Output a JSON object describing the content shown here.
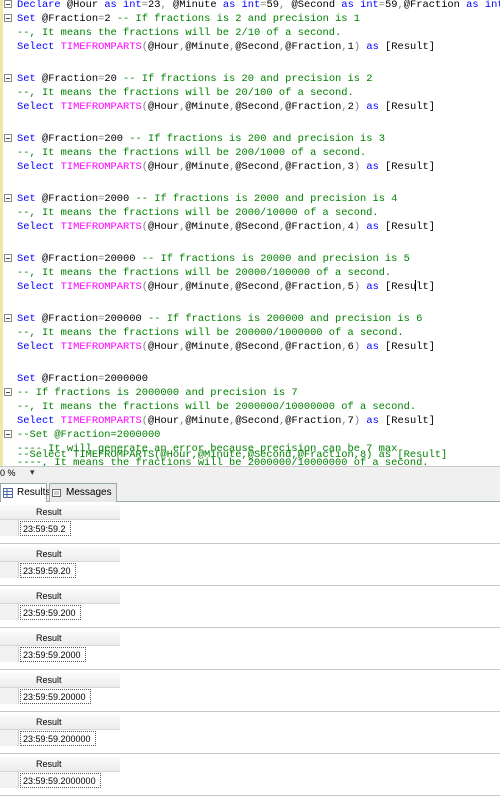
{
  "editor": {
    "lines": [
      {
        "fold": true,
        "segments": [
          [
            "kw",
            "Declare "
          ],
          [
            "var",
            "@Hour "
          ],
          [
            "kw",
            "as int"
          ],
          [
            "op",
            "="
          ],
          [
            "tx",
            "23"
          ],
          [
            "op",
            ", "
          ],
          [
            "var",
            "@Minute "
          ],
          [
            "kw",
            "as int"
          ],
          [
            "op",
            "="
          ],
          [
            "tx",
            "59"
          ],
          [
            "op",
            ", "
          ],
          [
            "var",
            "@Second "
          ],
          [
            "kw",
            "as int"
          ],
          [
            "op",
            "="
          ],
          [
            "tx",
            "59"
          ],
          [
            "op",
            ","
          ],
          [
            "var",
            "@Fraction "
          ],
          [
            "kw",
            "as int"
          ]
        ]
      },
      {
        "fold": true,
        "segments": [
          [
            "kw",
            "Set "
          ],
          [
            "var",
            "@Fraction"
          ],
          [
            "op",
            "="
          ],
          [
            "tx",
            "2 "
          ],
          [
            "cm",
            "-- If fractions is 2 and precision is 1"
          ]
        ]
      },
      {
        "fold": false,
        "segments": [
          [
            "cm",
            "--, It means the fractions will be 2/10 of a second."
          ]
        ]
      },
      {
        "fold": false,
        "segments": [
          [
            "kw",
            "Select "
          ],
          [
            "fn",
            "TIMEFROMPARTS"
          ],
          [
            "op",
            "("
          ],
          [
            "var",
            "@Hour"
          ],
          [
            "op",
            ","
          ],
          [
            "var",
            "@Minute"
          ],
          [
            "op",
            ","
          ],
          [
            "var",
            "@Second"
          ],
          [
            "op",
            ","
          ],
          [
            "var",
            "@Fraction"
          ],
          [
            "op",
            ","
          ],
          [
            "tx",
            "1"
          ],
          [
            "op",
            ") "
          ],
          [
            "kw",
            "as "
          ],
          [
            "tx",
            "[Result]"
          ]
        ]
      },
      {
        "fold": false,
        "segments": []
      },
      {
        "fold": true,
        "segments": [
          [
            "kw",
            "Set "
          ],
          [
            "var",
            "@Fraction"
          ],
          [
            "op",
            "="
          ],
          [
            "tx",
            "20 "
          ],
          [
            "cm",
            "-- If fractions is 20 and precision is 2"
          ]
        ]
      },
      {
        "fold": false,
        "segments": [
          [
            "cm",
            "--, It means the fractions will be 20/100 of a second."
          ]
        ]
      },
      {
        "fold": false,
        "segments": [
          [
            "kw",
            "Select "
          ],
          [
            "fn",
            "TIMEFROMPARTS"
          ],
          [
            "op",
            "("
          ],
          [
            "var",
            "@Hour"
          ],
          [
            "op",
            ","
          ],
          [
            "var",
            "@Minute"
          ],
          [
            "op",
            ","
          ],
          [
            "var",
            "@Second"
          ],
          [
            "op",
            ","
          ],
          [
            "var",
            "@Fraction"
          ],
          [
            "op",
            ","
          ],
          [
            "tx",
            "2"
          ],
          [
            "op",
            ") "
          ],
          [
            "kw",
            "as "
          ],
          [
            "tx",
            "[Result]"
          ]
        ]
      },
      {
        "fold": false,
        "segments": []
      },
      {
        "fold": true,
        "segments": [
          [
            "kw",
            "Set "
          ],
          [
            "var",
            "@Fraction"
          ],
          [
            "op",
            "="
          ],
          [
            "tx",
            "200 "
          ],
          [
            "cm",
            "-- If fractions is 200 and precision is 3"
          ]
        ]
      },
      {
        "fold": false,
        "segments": [
          [
            "cm",
            "--, It means the fractions will be 200/1000 of a second."
          ]
        ]
      },
      {
        "fold": false,
        "segments": [
          [
            "kw",
            "Select "
          ],
          [
            "fn",
            "TIMEFROMPARTS"
          ],
          [
            "op",
            "("
          ],
          [
            "var",
            "@Hour"
          ],
          [
            "op",
            ","
          ],
          [
            "var",
            "@Minute"
          ],
          [
            "op",
            ","
          ],
          [
            "var",
            "@Second"
          ],
          [
            "op",
            ","
          ],
          [
            "var",
            "@Fraction"
          ],
          [
            "op",
            ","
          ],
          [
            "tx",
            "3"
          ],
          [
            "op",
            ") "
          ],
          [
            "kw",
            "as "
          ],
          [
            "tx",
            "[Result]"
          ]
        ]
      },
      {
        "fold": false,
        "segments": []
      },
      {
        "fold": true,
        "segments": [
          [
            "kw",
            "Set "
          ],
          [
            "var",
            "@Fraction"
          ],
          [
            "op",
            "="
          ],
          [
            "tx",
            "2000 "
          ],
          [
            "cm",
            "-- If fractions is 2000 and precision is 4"
          ]
        ]
      },
      {
        "fold": false,
        "segments": [
          [
            "cm",
            "--, It means the fractions will be 2000/10000 of a second."
          ]
        ]
      },
      {
        "fold": false,
        "segments": [
          [
            "kw",
            "Select "
          ],
          [
            "fn",
            "TIMEFROMPARTS"
          ],
          [
            "op",
            "("
          ],
          [
            "var",
            "@Hour"
          ],
          [
            "op",
            ","
          ],
          [
            "var",
            "@Minute"
          ],
          [
            "op",
            ","
          ],
          [
            "var",
            "@Second"
          ],
          [
            "op",
            ","
          ],
          [
            "var",
            "@Fraction"
          ],
          [
            "op",
            ","
          ],
          [
            "tx",
            "4"
          ],
          [
            "op",
            ") "
          ],
          [
            "kw",
            "as "
          ],
          [
            "tx",
            "[Result]"
          ]
        ]
      },
      {
        "fold": false,
        "segments": []
      },
      {
        "fold": true,
        "segments": [
          [
            "kw",
            "Set "
          ],
          [
            "var",
            "@Fraction"
          ],
          [
            "op",
            "="
          ],
          [
            "tx",
            "20000 "
          ],
          [
            "cm",
            "-- If fractions is 20000 and precision is 5"
          ]
        ]
      },
      {
        "fold": false,
        "segments": [
          [
            "cm",
            "--, It means the fractions will be 20000/100000 of a second."
          ]
        ]
      },
      {
        "fold": false,
        "cursor": true,
        "segments": [
          [
            "kw",
            "Select "
          ],
          [
            "fn",
            "TIMEFROMPARTS"
          ],
          [
            "op",
            "("
          ],
          [
            "var",
            "@Hour"
          ],
          [
            "op",
            ","
          ],
          [
            "var",
            "@Minute"
          ],
          [
            "op",
            ","
          ],
          [
            "var",
            "@Second"
          ],
          [
            "op",
            ","
          ],
          [
            "var",
            "@Fraction"
          ],
          [
            "op",
            ","
          ],
          [
            "tx",
            "5"
          ],
          [
            "op",
            ") "
          ],
          [
            "kw",
            "as "
          ],
          [
            "tx",
            "[Resu"
          ],
          [
            "cur",
            ""
          ],
          [
            "tx",
            "lt]"
          ]
        ]
      },
      {
        "fold": false,
        "segments": []
      },
      {
        "fold": true,
        "segments": [
          [
            "kw",
            "Set "
          ],
          [
            "var",
            "@Fraction"
          ],
          [
            "op",
            "="
          ],
          [
            "tx",
            "200000 "
          ],
          [
            "cm",
            "-- If fractions is 200000 and precision is 6"
          ]
        ]
      },
      {
        "fold": false,
        "segments": [
          [
            "cm",
            "--, It means the fractions will be 200000/1000000 of a second."
          ]
        ]
      },
      {
        "fold": false,
        "segments": [
          [
            "kw",
            "Select "
          ],
          [
            "fn",
            "TIMEFROMPARTS"
          ],
          [
            "op",
            "("
          ],
          [
            "var",
            "@Hour"
          ],
          [
            "op",
            ","
          ],
          [
            "var",
            "@Minute"
          ],
          [
            "op",
            ","
          ],
          [
            "var",
            "@Second"
          ],
          [
            "op",
            ","
          ],
          [
            "var",
            "@Fraction"
          ],
          [
            "op",
            ","
          ],
          [
            "tx",
            "6"
          ],
          [
            "op",
            ") "
          ],
          [
            "kw",
            "as "
          ],
          [
            "tx",
            "[Result]"
          ]
        ]
      },
      {
        "fold": false,
        "segments": []
      },
      {
        "fold": false,
        "segments": [
          [
            "kw",
            "Set "
          ],
          [
            "var",
            "@Fraction"
          ],
          [
            "op",
            "="
          ],
          [
            "tx",
            "2000000"
          ]
        ]
      },
      {
        "fold": true,
        "segments": [
          [
            "cm",
            "-- If fractions is 2000000 and precision is 7"
          ]
        ]
      },
      {
        "fold": false,
        "segments": [
          [
            "cm",
            "--, It means the fractions will be 2000000/10000000 of a second."
          ]
        ]
      },
      {
        "fold": false,
        "segments": [
          [
            "kw",
            "Select "
          ],
          [
            "fn",
            "TIMEFROMPARTS"
          ],
          [
            "op",
            "("
          ],
          [
            "var",
            "@Hour"
          ],
          [
            "op",
            ","
          ],
          [
            "var",
            "@Minute"
          ],
          [
            "op",
            ","
          ],
          [
            "var",
            "@Second"
          ],
          [
            "op",
            ","
          ],
          [
            "var",
            "@Fraction"
          ],
          [
            "op",
            ","
          ],
          [
            "tx",
            "7"
          ],
          [
            "op",
            ") "
          ],
          [
            "kw",
            "as "
          ],
          [
            "tx",
            "[Result]"
          ]
        ]
      },
      {
        "fold": true,
        "segments": [
          [
            "cm",
            "--Set @Fraction=2000000"
          ]
        ]
      },
      {
        "fold": false,
        "segments": [
          [
            "cm",
            "---- It will generate an error because precision can be 7 max"
          ]
        ]
      },
      {
        "fold": false,
        "segments": [
          [
            "cm",
            "----, It means the fractions will be 2000000/10000000 of a second."
          ]
        ]
      },
      {
        "fold": false,
        "segments": [
          [
            "cm",
            "--Select TIMEFROMPARTS(@Hour,@Minute,@Second,@Fraction,8) as [Result]"
          ]
        ]
      }
    ]
  },
  "zoom": {
    "value": "0 %",
    "dropdown": "▾"
  },
  "tabs": {
    "results": "Results",
    "messages": "Messages"
  },
  "results": {
    "header": "Result",
    "values": [
      "23:59:59.2",
      "23:59:59.20",
      "23:59:59.200",
      "23:59:59.2000",
      "23:59:59.20000",
      "23:59:59.200000",
      "23:59:59.2000000"
    ]
  }
}
